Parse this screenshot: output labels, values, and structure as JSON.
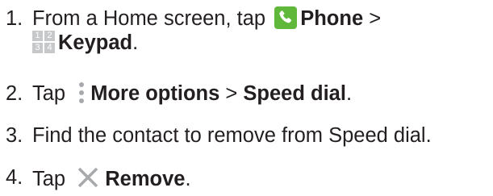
{
  "steps": [
    {
      "number": "1.",
      "line1_pre": "From a Home screen, tap",
      "phone_label": "Phone",
      "separator": ">",
      "keypad_label": "Keypad",
      "trail": ".",
      "keypad_digits": [
        "1",
        "2",
        "3",
        "4"
      ]
    },
    {
      "number": "2.",
      "pre": "Tap",
      "more_label": "More options",
      "separator": ">",
      "speed_label": "Speed dial",
      "trail": "."
    },
    {
      "number": "3.",
      "text": "Find the contact to remove from Speed dial."
    },
    {
      "number": "4.",
      "pre": "Tap",
      "remove_label": "Remove",
      "trail": "."
    }
  ],
  "icons": {
    "phone": "phone-icon",
    "keypad": "keypad-icon",
    "more_options": "more-options-icon",
    "remove": "close-icon"
  },
  "colors": {
    "text": "#231f20",
    "phone_icon_bg": "#5fb83a",
    "keypad_icon_bg": "#c7c8ca",
    "icon_gray": "#a7a9ac"
  }
}
